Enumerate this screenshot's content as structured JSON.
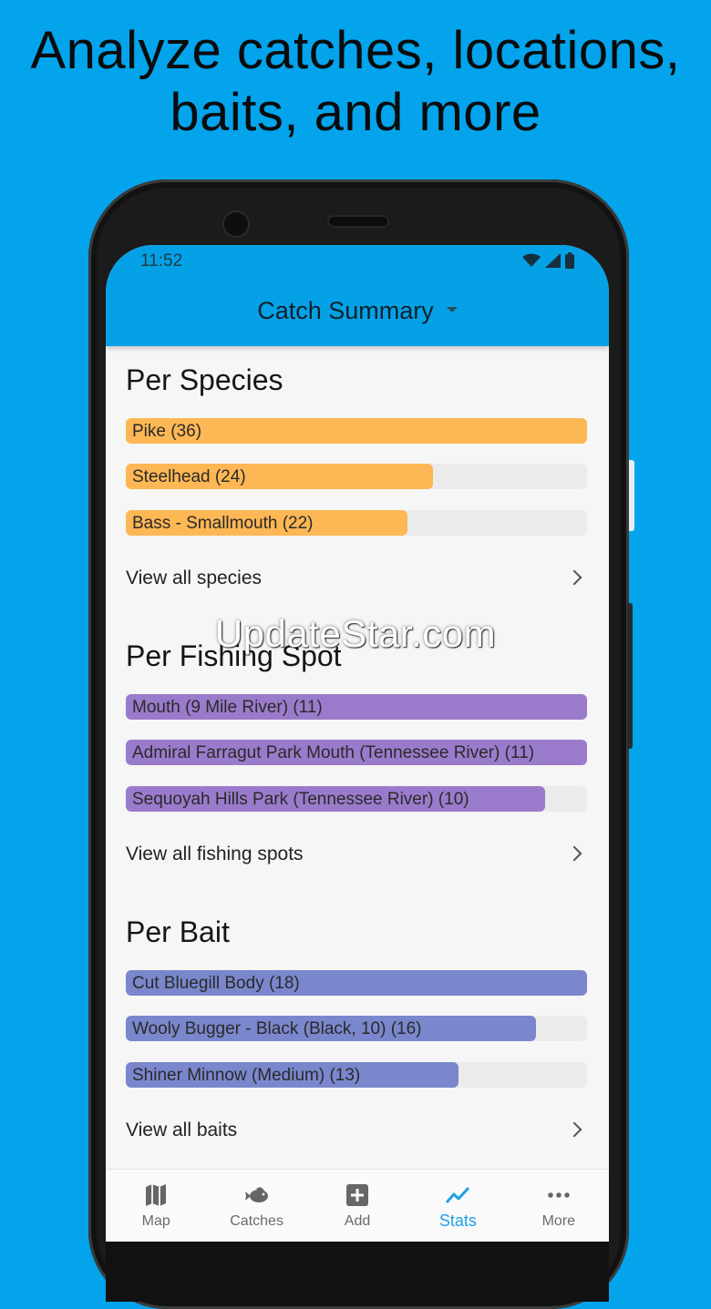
{
  "headline": {
    "line1": "Analyze catches, locations,",
    "line2": "baits, and more"
  },
  "status_bar": {
    "time": "11:52",
    "icons": [
      "wifi-icon",
      "signal-icon",
      "battery-icon"
    ]
  },
  "app_bar": {
    "title": "Catch Summary",
    "dropdown_icon": "caret-down-icon"
  },
  "sections": {
    "species": {
      "title": "Per Species",
      "accent_color": "#FDB754",
      "bars": [
        {
          "label": "Pike (36)",
          "value": 36
        },
        {
          "label": "Steelhead (24)",
          "value": 24
        },
        {
          "label": "Bass - Smallmouth (22)",
          "value": 22
        }
      ],
      "view_all": "View all species"
    },
    "fishing_spot": {
      "title": "Per Fishing Spot",
      "accent_color": "#9A7BCB",
      "bars": [
        {
          "label": "Mouth (9 Mile River) (11)",
          "value": 11
        },
        {
          "label": "Admiral Farragut Park Mouth (Tennessee River) (11)",
          "value": 11
        },
        {
          "label": "Sequoyah Hills Park (Tennessee River) (10)",
          "value": 10
        }
      ],
      "view_all": "View all fishing spots"
    },
    "bait": {
      "title": "Per Bait",
      "accent_color": "#7A87CD",
      "bars": [
        {
          "label": "Cut Bluegill Body (18)",
          "value": 18
        },
        {
          "label": "Wooly Bugger - Black (Black, 10) (16)",
          "value": 16
        },
        {
          "label": "Shiner Minnow (Medium) (13)",
          "value": 13
        }
      ],
      "view_all": "View all baits"
    }
  },
  "watermark": "UpdateStar.com",
  "bottom_nav": {
    "active_color": "#1DA1E6",
    "items": [
      {
        "label": "Map",
        "icon": "map-icon",
        "active": false
      },
      {
        "label": "Catches",
        "icon": "fish-icon",
        "active": false
      },
      {
        "label": "Add",
        "icon": "add-icon",
        "active": false
      },
      {
        "label": "Stats",
        "icon": "stats-icon",
        "active": true
      },
      {
        "label": "More",
        "icon": "more-icon",
        "active": false
      }
    ]
  }
}
